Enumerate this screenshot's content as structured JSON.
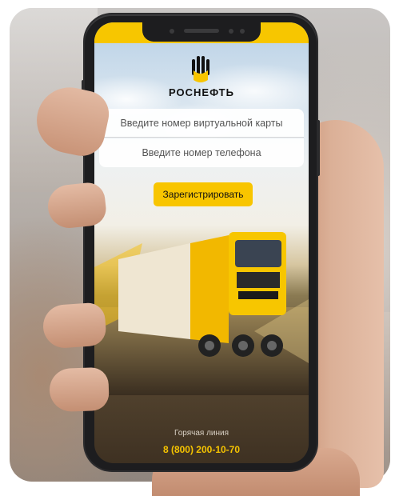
{
  "app": {
    "brand": "РОСНЕФТЬ"
  },
  "form": {
    "card_placeholder": "Введите номер виртуальной карты",
    "phone_placeholder": "Введите номер телефона",
    "register_button": "Зарегистрировать"
  },
  "footer": {
    "hotline_label": "Горячая линия",
    "hotline_number": "8 (800) 200-10-70"
  },
  "colors": {
    "accent": "#F8C500",
    "brand_text": "#111111"
  },
  "icons": {
    "logo": "rosneft-logo-icon"
  }
}
